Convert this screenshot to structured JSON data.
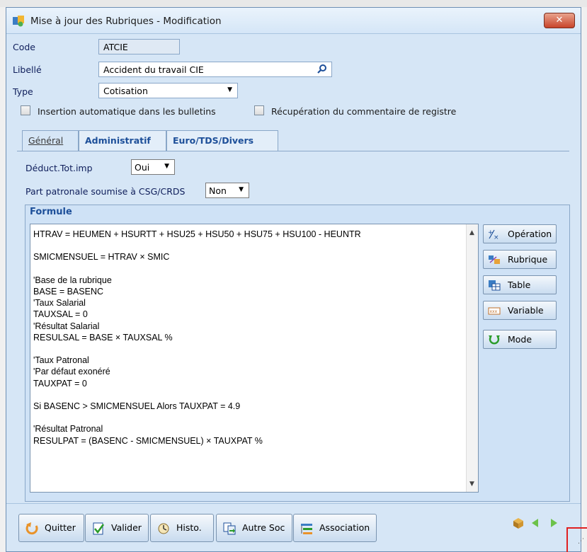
{
  "window": {
    "title": "Mise à jour des Rubriques - Modification",
    "close_label": "✕"
  },
  "fields": {
    "code_label": "Code",
    "code_value": "ATCIE",
    "libelle_label": "Libellé",
    "libelle_value": "Accident du travail CIE",
    "type_label": "Type",
    "type_value": "Cotisation"
  },
  "checkboxes": {
    "insertion_label": "Insertion automatique dans les bulletins",
    "recuperation_label": "Récupération du commentaire de registre"
  },
  "tabs": [
    {
      "label": "Général"
    },
    {
      "label": "Administratif"
    },
    {
      "label": "Euro/TDS/Divers"
    }
  ],
  "general": {
    "deduct_label": "Déduct.Tot.imp",
    "deduct_value": "Oui",
    "part_label": "Part patronale soumise à CSG/CRDS",
    "part_value": "Non"
  },
  "formule": {
    "title": "Formule",
    "lines": [
      "HTRAV = HEUMEN + HSURTT + HSU25 + HSU50 + HSU75 + HSU100 - HEUNTR",
      "",
      "SMICMENSUEL = HTRAV × SMIC",
      "",
      "'Base de la rubrique",
      "BASE = BASENC",
      "'Taux Salarial",
      "TAUXSAL = 0",
      "'Résultat Salarial",
      "RESULSAL = BASE × TAUXSAL %",
      "",
      "'Taux Patronal",
      "'Par défaut exonéré",
      "TAUXPAT = 0",
      "",
      "Si BASENC > SMICMENSUEL Alors TAUXPAT = 4.9",
      "",
      "'Résultat Patronal",
      "RESULPAT = (BASENC - SMICMENSUEL) × TAUXPAT %"
    ]
  },
  "side_buttons": {
    "operation": "Opération",
    "rubrique": "Rubrique",
    "table": "Table",
    "variable": "Variable",
    "mode": "Mode"
  },
  "bottom_buttons": {
    "quitter": "Quitter",
    "valider": "Valider",
    "histo": "Histo.",
    "autre_soc": "Autre Soc",
    "association": "Association"
  },
  "colors": {
    "accent": "#1d4f99",
    "window_bg": "#d6e6f6",
    "close": "#c8442a"
  }
}
